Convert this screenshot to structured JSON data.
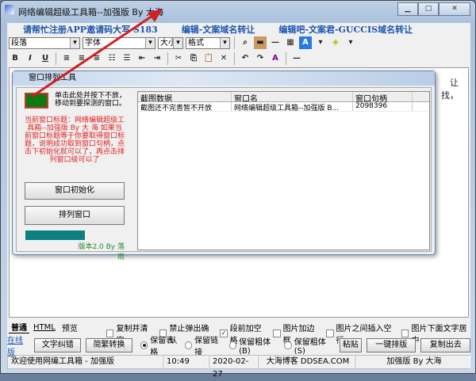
{
  "window": {
    "title": "网络编辑超级工具箱--加强版 By 大海"
  },
  "links": [
    "请帮忙注册APP邀请码大写 S183",
    "编辑-文案域名转让",
    "编辑吧-文案君-GUCCIS域名转让"
  ],
  "toolbar": {
    "paragraph": "段落",
    "font": "字体",
    "size": "大小",
    "format": "格式"
  },
  "editor_bg_text": [
    "让",
    "找，"
  ],
  "dialog": {
    "title": "窗口排列工具",
    "finder_hint": "单击此处并按下不放，移动到要探测的窗口。",
    "info": "当前窗口标题：网络编辑超级工具箱--加强版 By 大 海 如果当前窗口标题等于你要取得窗口标题，说明成功取到窗口句柄，点击下初始化就可以了，再点击排列窗口级可以了",
    "init_button": "窗口初始化",
    "arrange_button": "排列窗口",
    "progress": 0.65,
    "version": "版本2.0 By 落雨",
    "columns": [
      "截图数据",
      "窗口名",
      "窗口句柄"
    ],
    "rows": [
      [
        "截图还不完善暂不开放",
        "网络编辑超级工具箱--加强版 B...",
        "2098396"
      ]
    ]
  },
  "tabs": [
    "普通",
    "HTML",
    "预览"
  ],
  "options": [
    {
      "label": "复制并清空",
      "checked": false
    },
    {
      "label": "禁止弹出确认",
      "checked": false
    },
    {
      "label": "段前加空格",
      "checked": true
    },
    {
      "label": "图片加边框",
      "checked": false
    },
    {
      "label": "图片之间插入空行",
      "checked": false
    },
    {
      "label": "图片下面文字居中",
      "checked": false
    }
  ],
  "actions": {
    "online": "在线版",
    "proofread": "文字纠错",
    "convert": "简繁转换",
    "paste": "粘贴",
    "format": "一键排版",
    "copy_out": "复制出去"
  },
  "radios": [
    {
      "label": "保留表格",
      "checked": true
    },
    {
      "label": "保留链接",
      "checked": false
    },
    {
      "label": "保留粗体(B)",
      "checked": false
    },
    {
      "label": "保留粗体(S)",
      "checked": false
    }
  ],
  "status": [
    "欢迎使用网编工具箱 - 加强版",
    "10:49",
    "2020-02-27",
    "大海博客 DDSEA.COM",
    "加强版 By 大海"
  ]
}
